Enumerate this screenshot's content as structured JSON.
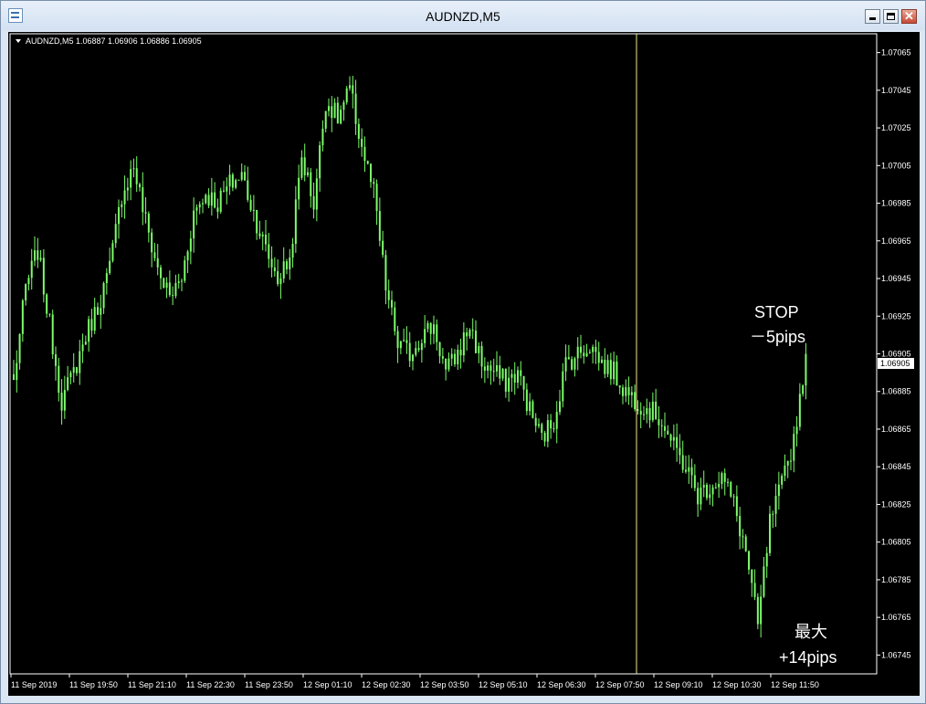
{
  "window": {
    "title": "AUDNZD,M5",
    "icon": "chart-window-icon"
  },
  "controls": {
    "minimize": "minimize-icon",
    "maximize": "maximize-icon",
    "close_label": "✕"
  },
  "header": {
    "info": "AUDNZD,M5  1.06887 1.06906 1.06886 1.06905"
  },
  "annotations": {
    "stop_line1": "STOP",
    "stop_line2": "－5pips",
    "max_line1": "最大",
    "max_line2": "+14pips"
  },
  "colors": {
    "background": "#000000",
    "candle": "#7CFC6A",
    "frame": "#ffffff",
    "vline": "#f0e68c",
    "price_tag_bg": "#ffffff"
  },
  "chart_data": {
    "type": "candlestick",
    "symbol": "AUDNZD",
    "timeframe": "M5",
    "ylim": [
      1.06735,
      1.07075
    ],
    "y_ticks": [
      "1.07065",
      "1.07045",
      "1.07025",
      "1.07005",
      "1.06985",
      "1.06965",
      "1.06945",
      "1.06925",
      "1.06905",
      "1.06885",
      "1.06865",
      "1.06845",
      "1.06825",
      "1.06805",
      "1.06785",
      "1.06765",
      "1.06745"
    ],
    "current_price": "1.06905",
    "x_labels": [
      "11 Sep 2019",
      "11 Sep 19:50",
      "11 Sep 21:10",
      "11 Sep 22:30",
      "11 Sep 23:50",
      "12 Sep 01:10",
      "12 Sep 02:30",
      "12 Sep 03:50",
      "12 Sep 05:10",
      "12 Sep 06:30",
      "12 Sep 07:50",
      "12 Sep 09:10",
      "12 Sep 10:30",
      "12 Sep 11:50"
    ],
    "closes": [
      1.0689,
      1.0694,
      1.0696,
      1.0692,
      1.0688,
      1.06895,
      1.06915,
      1.0693,
      1.0695,
      1.0699,
      1.07005,
      1.06975,
      1.0695,
      1.06935,
      1.06945,
      1.0698,
      1.0699,
      1.06985,
      1.06995,
      1.07,
      1.0698,
      1.0696,
      1.06945,
      1.06955,
      1.0701,
      1.06985,
      1.0704,
      1.0703,
      1.07045,
      1.07015,
      1.0699,
      1.0694,
      1.0691,
      1.06905,
      1.06915,
      1.0692,
      1.06895,
      1.06905,
      1.0692,
      1.069,
      1.06895,
      1.0689,
      1.06895,
      1.06875,
      1.0686,
      1.0687,
      1.069,
      1.06905,
      1.0691,
      1.069,
      1.06895,
      1.06885,
      1.0688,
      1.06875,
      1.0687,
      1.06855,
      1.06845,
      1.0683,
      1.06835,
      1.0684,
      1.06825,
      1.068,
      1.0676,
      1.06815,
      1.06835,
      1.0686,
      1.06905
    ],
    "sample_step_minutes": 20,
    "vertical_line_label": "12 Sep 07:50"
  }
}
